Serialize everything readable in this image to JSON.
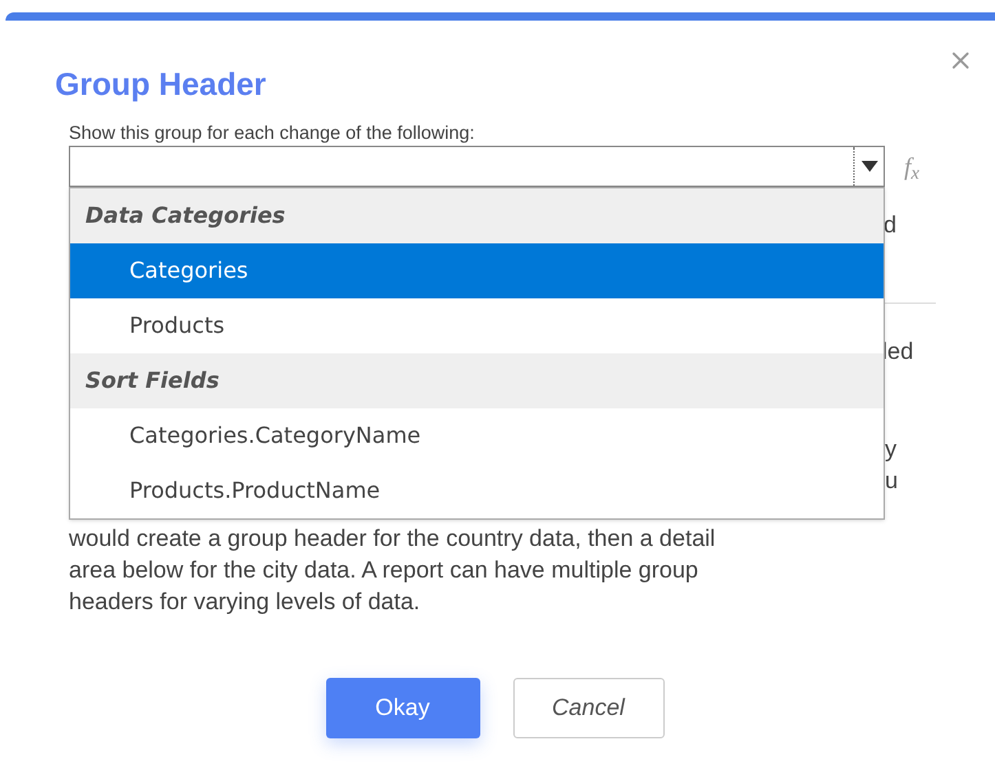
{
  "dialog": {
    "title": "Group Header"
  },
  "field": {
    "label": "Show this group for each change of the following:",
    "formula_button": "f$_{x}$"
  },
  "dropdown": {
    "groups": [
      {
        "label": "Data Categories",
        "options": [
          {
            "label": "Categories",
            "selected": true
          },
          {
            "label": "Products",
            "selected": false
          }
        ]
      },
      {
        "label": "Sort Fields",
        "options": [
          {
            "label": "Categories.CategoryName",
            "selected": false
          },
          {
            "label": "Products.ProductName",
            "selected": false
          }
        ]
      }
    ]
  },
  "background_text": {
    "fragments": [
      "d",
      "led",
      "y",
      "u"
    ],
    "paragraph_lines": [
      "would create a group header for the country data, then a detail",
      "area below for the city data. A report can have multiple group",
      "headers for varying levels of data."
    ]
  },
  "buttons": [
    {
      "label": "Okay",
      "kind": "primary"
    },
    {
      "label": "Cancel",
      "kind": "secondary"
    }
  ]
}
